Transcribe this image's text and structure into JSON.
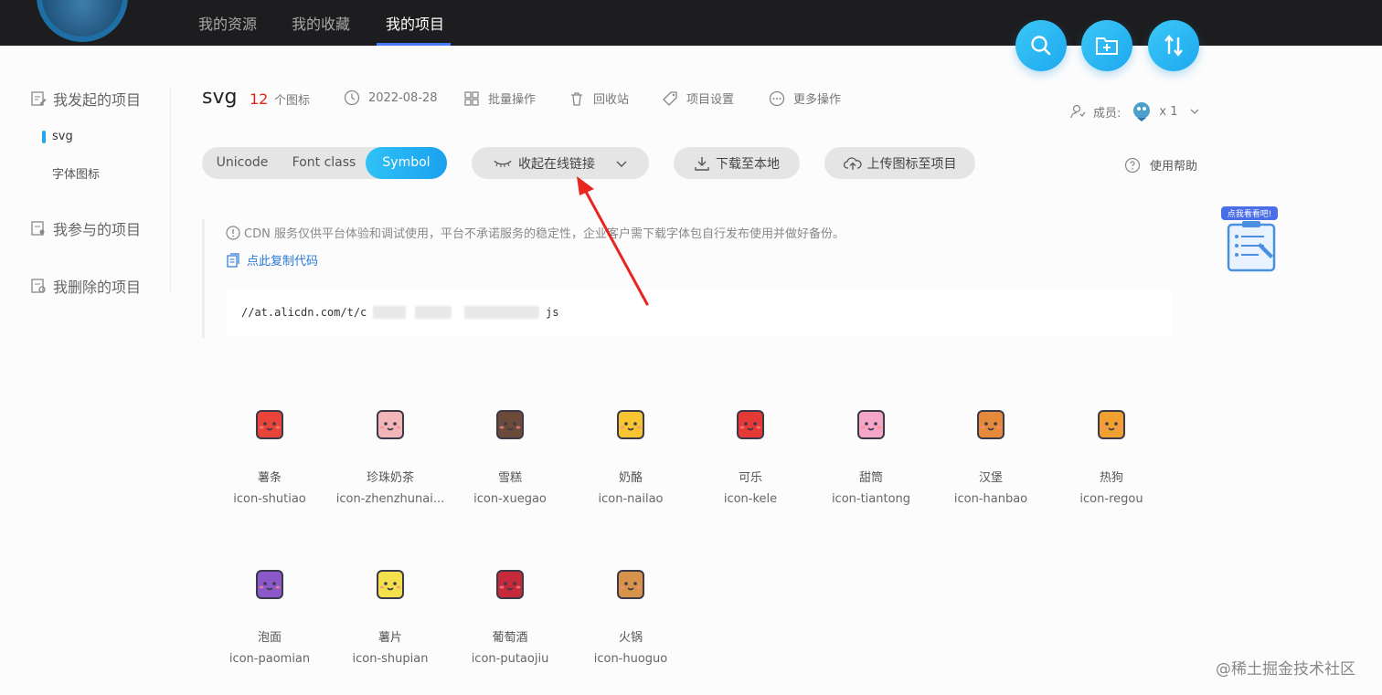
{
  "nav": {
    "items": [
      "我的资源",
      "我的收藏",
      "我的项目"
    ],
    "active_index": 2
  },
  "fab": [
    "search-icon",
    "new-folder-icon",
    "sort-icon"
  ],
  "sidebar": {
    "initiated": "我发起的项目",
    "projects": [
      "svg",
      "字体图标"
    ],
    "participated": "我参与的项目",
    "deleted": "我删除的项目"
  },
  "project": {
    "name": "svg",
    "count": "12",
    "count_label": "个图标",
    "date": "2022-08-28",
    "batch": "批量操作",
    "recycle": "回收站",
    "settings": "项目设置",
    "more": "更多操作",
    "members_label": "成员:",
    "members_count": "x 1"
  },
  "toolbar": {
    "tabs": [
      "Unicode",
      "Font class",
      "Symbol"
    ],
    "active_tab": "Symbol",
    "collapse_link": "收起在线链接",
    "download": "下载至本地",
    "upload": "上传图标至项目",
    "help": "使用帮助"
  },
  "notice": {
    "text": "CDN 服务仅供平台体验和调试使用，平台不承诺服务的稳定性，企业客户需下载字体包自行发布使用并做好备份。",
    "copy": "点此复制代码",
    "code_prefix": "//at.alicdn.com/t/c",
    "code_suffix": "js"
  },
  "helper_badge": "点我看看吧!",
  "icons": [
    {
      "name": "薯条",
      "code": "icon-shutiao",
      "color": "#e8443a"
    },
    {
      "name": "珍珠奶茶",
      "code": "icon-zhenzhunai...",
      "color": "#f3b6b8"
    },
    {
      "name": "雪糕",
      "code": "icon-xuegao",
      "color": "#6b4a3a"
    },
    {
      "name": "奶酪",
      "code": "icon-nailao",
      "color": "#f7c531"
    },
    {
      "name": "可乐",
      "code": "icon-kele",
      "color": "#e53935"
    },
    {
      "name": "甜筒",
      "code": "icon-tiantong",
      "color": "#f6a6c6"
    },
    {
      "name": "汉堡",
      "code": "icon-hanbao",
      "color": "#e58a3a"
    },
    {
      "name": "热狗",
      "code": "icon-regou",
      "color": "#f0a030"
    },
    {
      "name": "泡面",
      "code": "icon-paomian",
      "color": "#8a58c8"
    },
    {
      "name": "薯片",
      "code": "icon-shupian",
      "color": "#f4e04d"
    },
    {
      "name": "葡萄酒",
      "code": "icon-putaojiu",
      "color": "#c62a3a"
    },
    {
      "name": "火锅",
      "code": "icon-huoguo",
      "color": "#d8934a"
    }
  ],
  "watermark": "@稀土掘金技术社区"
}
